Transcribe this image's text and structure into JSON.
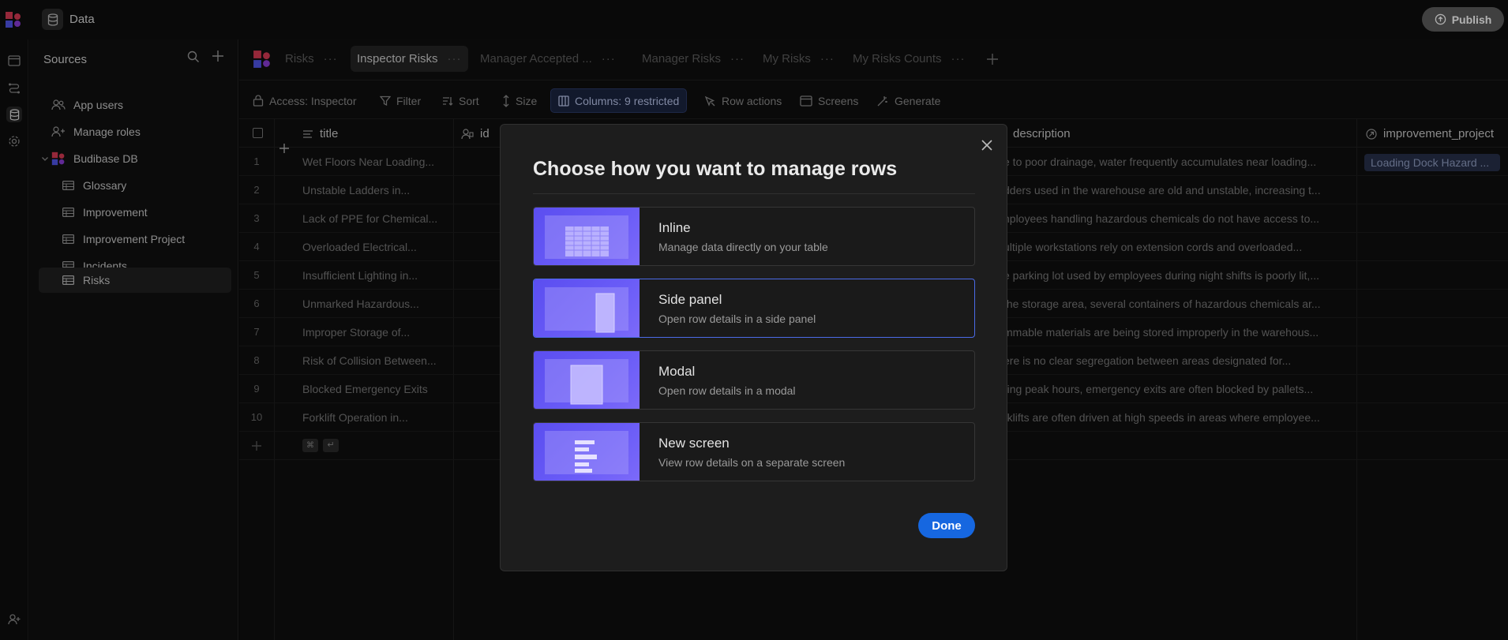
{
  "topbar": {
    "title": "Data",
    "publish_label": "Publish"
  },
  "sidebar": {
    "heading": "Sources",
    "items": [
      {
        "label": "App users",
        "icon": "users-icon"
      },
      {
        "label": "Manage roles",
        "icon": "user-roles-icon"
      },
      {
        "label": "Budibase DB",
        "icon": "budibase-db-icon"
      },
      {
        "label": "Glossary",
        "icon": "table-icon"
      },
      {
        "label": "Improvement",
        "icon": "table-icon"
      },
      {
        "label": "Improvement Project",
        "icon": "table-icon"
      },
      {
        "label": "Incidents",
        "icon": "table-icon"
      },
      {
        "label": "Risks",
        "icon": "table-icon"
      }
    ]
  },
  "tabs": [
    {
      "label": "Risks"
    },
    {
      "label": "Inspector Risks"
    },
    {
      "label": "Manager Accepted ..."
    },
    {
      "label": "Manager Risks"
    },
    {
      "label": "My Risks"
    },
    {
      "label": "My Risks Counts"
    }
  ],
  "toolbar": {
    "access": "Access: Inspector",
    "filter": "Filter",
    "sort": "Sort",
    "size": "Size",
    "columns": "Columns: 9 restricted",
    "row_actions": "Row actions",
    "screens": "Screens",
    "generate": "Generate"
  },
  "grid": {
    "columns": {
      "title": "title",
      "id": "id",
      "description": "description",
      "improvement_project": "improvement_project"
    },
    "rows": [
      {
        "n": "1",
        "title": "Wet Floors Near Loading...",
        "desc": "e to poor drainage, water frequently accumulates near loading...",
        "project": "Loading Dock Hazard ..."
      },
      {
        "n": "2",
        "title": "Unstable Ladders in...",
        "desc": "dders used in the warehouse are old and unstable, increasing t..."
      },
      {
        "n": "3",
        "title": "Lack of PPE for Chemical...",
        "desc": "nployees handling hazardous chemicals do not have access to..."
      },
      {
        "n": "4",
        "title": "Overloaded Electrical...",
        "desc": "ultiple workstations rely on extension cords and overloaded..."
      },
      {
        "n": "5",
        "title": "Insufficient Lighting in...",
        "desc": "e parking lot used by employees during night shifts is poorly lit,..."
      },
      {
        "n": "6",
        "title": "Unmarked Hazardous...",
        "desc": "the storage area, several containers of hazardous chemicals ar..."
      },
      {
        "n": "7",
        "title": "Improper Storage of...",
        "desc": "mmable materials are being stored improperly in the warehous..."
      },
      {
        "n": "8",
        "title": "Risk of Collision Between...",
        "desc": "ere is no clear segregation between areas designated for..."
      },
      {
        "n": "9",
        "title": "Blocked Emergency Exits",
        "desc": "ring peak hours, emergency exits are often blocked by pallets..."
      },
      {
        "n": "10",
        "title": "Forklift Operation in...",
        "desc": "rklifts are often driven at high speeds in areas where employee..."
      }
    ]
  },
  "modal": {
    "title": "Choose how you want to manage rows",
    "options": [
      {
        "label": "Inline",
        "desc": "Manage data directly on your table"
      },
      {
        "label": "Side panel",
        "desc": "Open row details in a side panel"
      },
      {
        "label": "Modal",
        "desc": "Open row details in a modal"
      },
      {
        "label": "New screen",
        "desc": "View row details on a separate screen"
      }
    ],
    "selected": "Side panel",
    "done_label": "Done"
  },
  "colors": {
    "accent": "#1667e0",
    "thumb": "#5b4ef0",
    "selected_border": "#4b6be8"
  }
}
